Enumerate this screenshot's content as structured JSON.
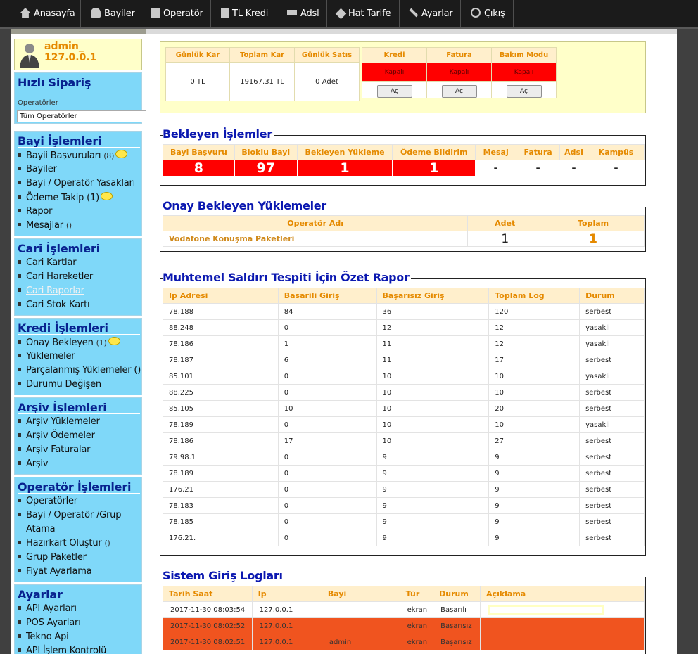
{
  "nav": {
    "items": [
      {
        "label": "Anasayfa",
        "icon": "home-icon"
      },
      {
        "label": "Bayiler",
        "icon": "user-icon"
      },
      {
        "label": "Operatör",
        "icon": "phone-icon"
      },
      {
        "label": "TL Kredi",
        "icon": "calculator-icon"
      },
      {
        "label": "Adsl",
        "icon": "modem-icon"
      },
      {
        "label": "Hat Tarife",
        "icon": "tag-icon"
      },
      {
        "label": "Ayarlar",
        "icon": "wrench-icon"
      },
      {
        "label": "Çıkış",
        "icon": "power-icon"
      }
    ]
  },
  "user": {
    "name": "admin_",
    "ip": "127.0.0.1"
  },
  "hizli": {
    "title": "Hızlı Sipariş",
    "label": "Operatörler",
    "select": "Tüm Operatörler"
  },
  "bayi": {
    "title": "Bayi İşlemleri",
    "items": [
      {
        "label": "Bayii Başvuruları",
        "count": "(8)"
      },
      {
        "label": "Bayiler",
        "count": ""
      },
      {
        "label": "Bayi / Operatör Yasakları",
        "count": ""
      },
      {
        "label": "Ödeme Takip (1)",
        "count": ""
      },
      {
        "label": "Rapor",
        "count": ""
      },
      {
        "label": "Mesajlar",
        "count": "()"
      }
    ]
  },
  "cari": {
    "title": "Cari İşlemleri",
    "items": [
      "Cari Kartlar",
      "Cari Hareketler",
      "Cari Raporlar",
      "Cari Stok Kartı"
    ]
  },
  "kredi": {
    "title": "Kredi İşlemleri",
    "items": [
      {
        "label": "Onay Bekleyen",
        "count": "(1)"
      },
      {
        "label": "Yüklemeler",
        "count": ""
      },
      {
        "label": "Parçalanmış Yüklemeler ()",
        "count": ""
      },
      {
        "label": "Durumu Değişen",
        "count": ""
      }
    ]
  },
  "arsiv": {
    "title": "Arşiv İşlemleri",
    "items": [
      "Arşiv Yüklemeler",
      "Arşiv Ödemeler",
      "Arşiv Faturalar",
      "Arşiv"
    ]
  },
  "operator": {
    "title": "Operatör İşlemleri",
    "items": [
      {
        "label": "Operatörler",
        "count": ""
      },
      {
        "label": "Bayi / Operatör /Grup",
        "count": ""
      },
      {
        "label": "Atama",
        "count": ""
      },
      {
        "label": "Hazırkart Oluştur",
        "count": "()"
      },
      {
        "label": "Grup Paketler",
        "count": ""
      },
      {
        "label": "Fiyat Ayarlama",
        "count": ""
      }
    ]
  },
  "ayarlar": {
    "title": "Ayarlar",
    "items": [
      "API Ayarları",
      "POS Ayarları",
      "Tekno Api",
      "API İşlem Kontrolü"
    ]
  },
  "stats": {
    "headers": [
      "Günlük Kar",
      "Toplam Kar",
      "Günlük Satış"
    ],
    "values": [
      "0 TL",
      "19167.31 TL",
      "0 Adet"
    ]
  },
  "toggles": {
    "headers": [
      "Kredi",
      "Fatura",
      "Bakım Modu"
    ],
    "states": [
      "Kapalı",
      "Kapalı",
      "Kapalı"
    ],
    "button": "Aç"
  },
  "bekleyen": {
    "title": "Bekleyen İşlemler",
    "headers": [
      "Bayi Başvuru",
      "Bloklu Bayi",
      "Bekleyen Yükleme",
      "Ödeme Bildirim",
      "Mesaj",
      "Fatura",
      "Adsl",
      "Kampüs"
    ],
    "values": [
      "8",
      "97",
      "1",
      "1",
      "-",
      "-",
      "-",
      "-"
    ]
  },
  "onay": {
    "title": "Onay Bekleyen Yüklemeler",
    "headers": [
      "Operatör Adı",
      "Adet",
      "Toplam"
    ],
    "rows": [
      {
        "operator": "Vodafone Konuşma Paketleri",
        "adet": "1",
        "toplam": "1"
      }
    ]
  },
  "saldiri": {
    "title": "Muhtemel Saldırı Tespiti İçin Özet Rapor",
    "headers": [
      "Ip Adresi",
      "Basarili Giriş",
      "Başarısız Giriş",
      "Toplam Log",
      "Durum"
    ],
    "rows": [
      [
        "78.188",
        "84",
        "36",
        "120",
        "serbest"
      ],
      [
        "88.248",
        "0",
        "12",
        "12",
        "yasakli"
      ],
      [
        "78.186",
        "1",
        "11",
        "12",
        "yasakli"
      ],
      [
        "78.187",
        "6",
        "11",
        "17",
        "serbest"
      ],
      [
        "85.101",
        "0",
        "10",
        "10",
        "yasakli"
      ],
      [
        "88.225",
        "0",
        "10",
        "10",
        "serbest"
      ],
      [
        "85.105",
        "10",
        "10",
        "20",
        "serbest"
      ],
      [
        "78.189",
        "0",
        "10",
        "10",
        "yasakli"
      ],
      [
        "78.186",
        "17",
        "10",
        "27",
        "serbest"
      ],
      [
        "79.98.1",
        "0",
        "9",
        "9",
        "serbest"
      ],
      [
        "78.189",
        "0",
        "9",
        "9",
        "serbest"
      ],
      [
        "176.21",
        "0",
        "9",
        "9",
        "serbest"
      ],
      [
        "78.183",
        "0",
        "9",
        "9",
        "serbest"
      ],
      [
        "78.185",
        "0",
        "9",
        "9",
        "serbest"
      ],
      [
        "176.21.",
        "0",
        "9",
        "9",
        "serbest"
      ]
    ]
  },
  "loglar": {
    "title": "Sistem Giriş Logları",
    "headers": [
      "Tarih Saat",
      "Ip",
      "Bayi",
      "Tür",
      "Durum",
      "Açıklama"
    ],
    "rows": [
      [
        "2017-11-30 08:03:54",
        "127.0.0.1",
        "",
        "ekran",
        "Başarılı",
        ""
      ],
      [
        "2017-11-30 08:02:52",
        "127.0.0.1",
        "",
        "ekran",
        "Başarısız",
        ""
      ],
      [
        "2017-11-30 08:02:51",
        "127.0.0.1",
        "admin",
        "ekran",
        "Başarısız",
        ""
      ]
    ]
  },
  "colors": {
    "accent": "#e58a00",
    "panel": "#7fd8f9",
    "heading": "#08228f",
    "alert": "#ff0000",
    "fail_row": "#f0541f"
  }
}
